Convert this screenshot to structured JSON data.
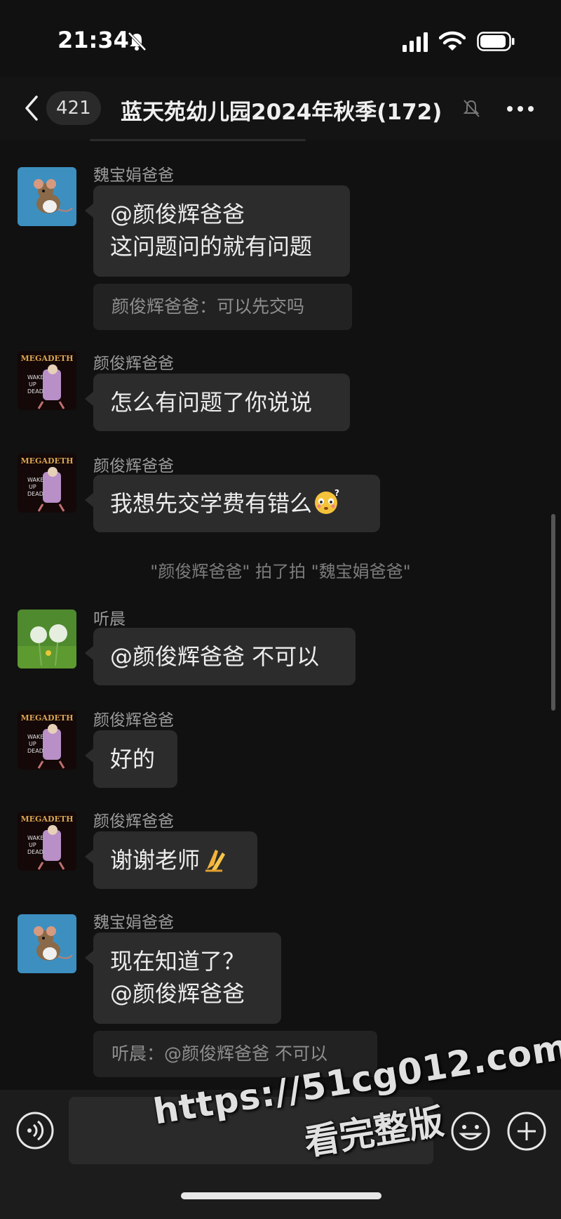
{
  "status_bar": {
    "time": "21:34"
  },
  "header": {
    "unread_count": "421",
    "title": "蓝天苑幼儿园2024年秋季(172)"
  },
  "messages": [
    {
      "sender": "魏宝娟爸爸",
      "text": "@颜俊辉爸爸\n这问题问的就有问题",
      "quote": "颜俊辉爸爸：可以先交吗"
    },
    {
      "sender": "颜俊辉爸爸",
      "text": "怎么有问题了你说说"
    },
    {
      "sender": "颜俊辉爸爸",
      "text": "我想先交学费有错么",
      "emoji": "flushed-face-emoji"
    },
    {
      "system": "\"颜俊辉爸爸\" 拍了拍 \"魏宝娟爸爸\""
    },
    {
      "sender": "听晨",
      "text": "@颜俊辉爸爸 不可以"
    },
    {
      "sender": "颜俊辉爸爸",
      "text": "好的"
    },
    {
      "sender": "颜俊辉爸爸",
      "text": "谢谢老师",
      "emoji": "folded-hands-emoji"
    },
    {
      "sender": "魏宝娟爸爸",
      "text": "现在知道了？\n@颜俊辉爸爸",
      "quote": "听晨：@颜俊辉爸爸 不可以"
    }
  ],
  "watermark": {
    "url": "https://51cg012.com",
    "cta": "看完整版"
  },
  "colors": {
    "background": "#111111",
    "bubble": "#2c2c2c",
    "quote": "#222222",
    "input_bar": "#1c1c1c"
  }
}
